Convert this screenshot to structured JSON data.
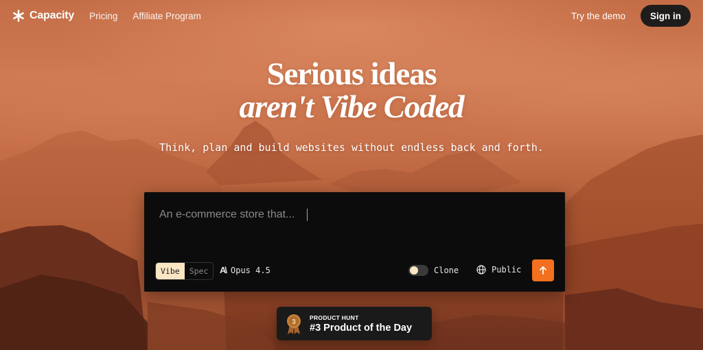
{
  "nav": {
    "brand": "Capacity",
    "links": [
      "Pricing",
      "Affiliate Program"
    ],
    "try_demo": "Try the demo",
    "sign_in": "Sign in"
  },
  "hero": {
    "title_line1": "Serious ideas",
    "title_line2": "aren't Vibe Coded",
    "subtitle": "Think, plan and build websites without endless back and forth."
  },
  "prompt": {
    "placeholder": "An e-commerce store that...",
    "mode_options": [
      "Vibe",
      "Spec"
    ],
    "mode_selected": "Vibe",
    "model": "Opus 4.5",
    "model_icon": "anthropic-icon",
    "clone_label": "Clone",
    "clone_enabled": false,
    "visibility_label": "Public",
    "visibility_icon": "globe-icon",
    "submit_icon": "arrow-up-icon"
  },
  "badge": {
    "kicker": "PRODUCT HUNT",
    "title": "#3 Product of the Day",
    "rank": "3"
  },
  "colors": {
    "accent": "#f2701f",
    "prompt_bg": "#0c0c0c",
    "mode_selected_bg": "#fbe6c4",
    "signin_bg": "#1f1d1c",
    "medal": "#c8823a"
  }
}
